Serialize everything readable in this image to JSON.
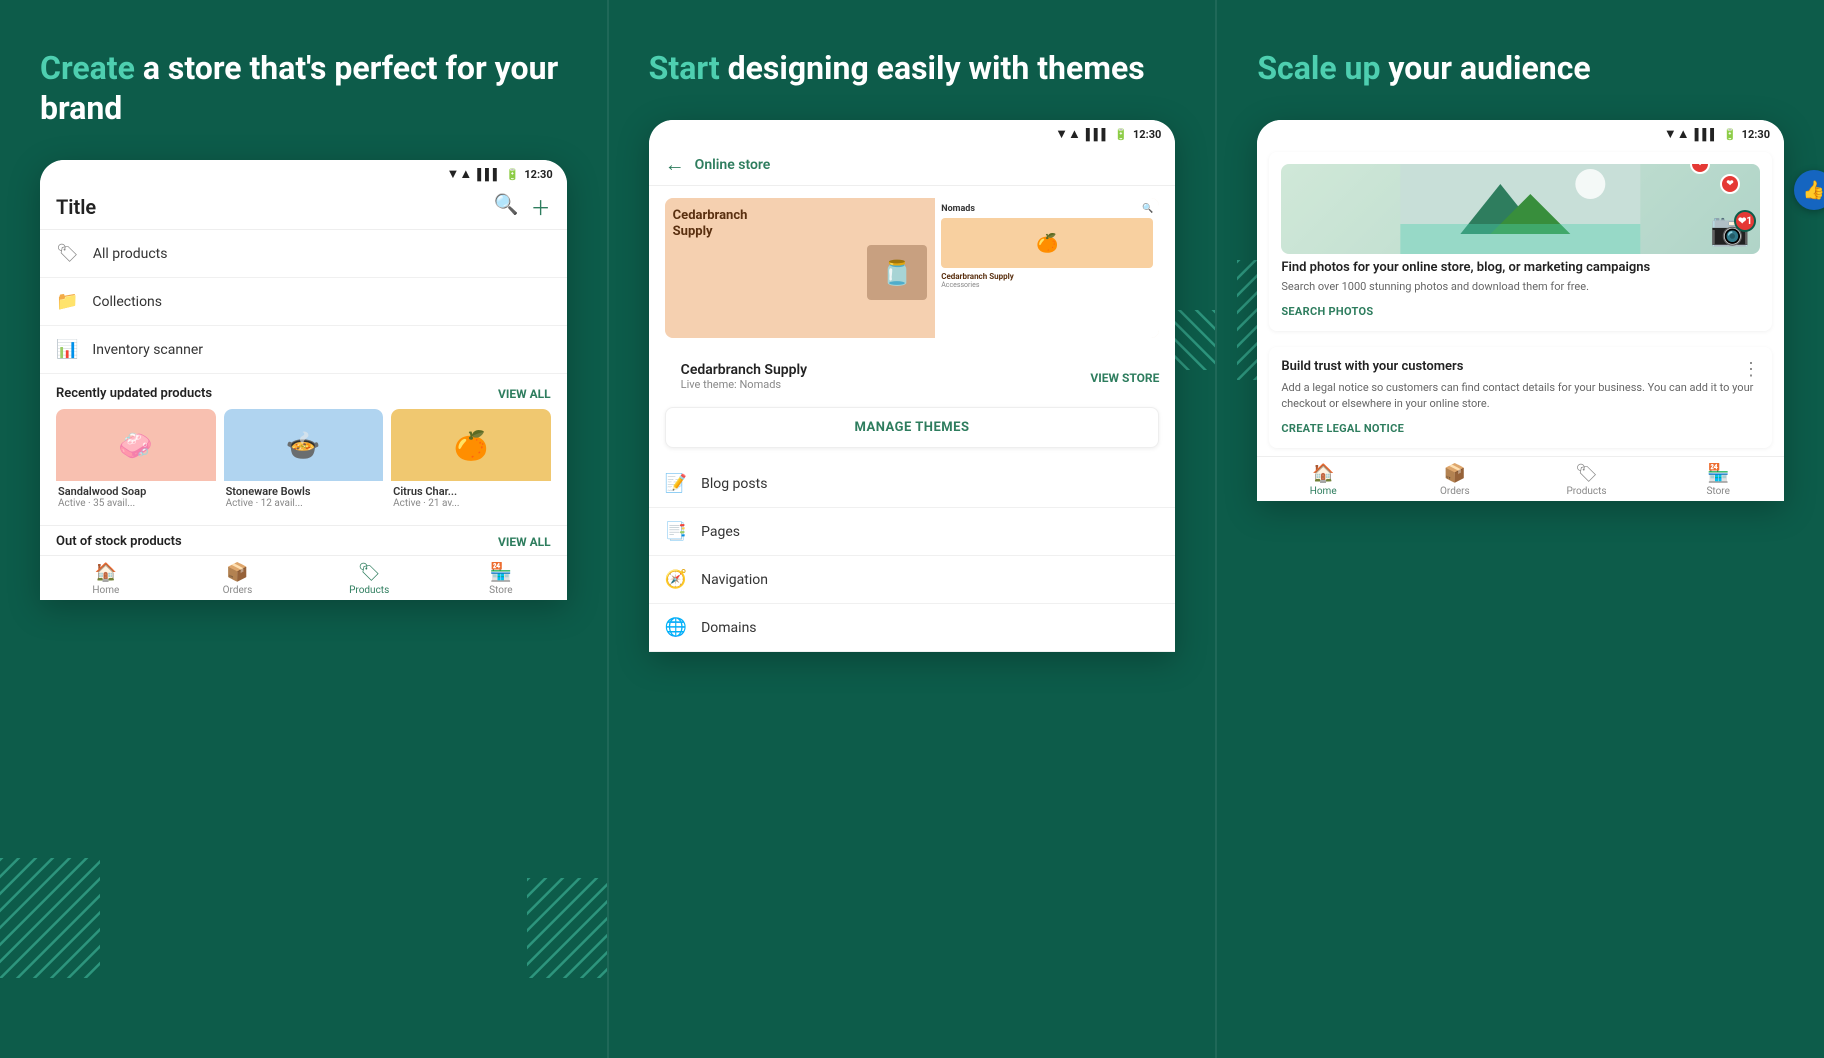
{
  "panel1": {
    "headline_accent": "Create",
    "headline_rest": " a store that's perfect for your brand",
    "phone": {
      "status_time": "12:30",
      "title": "Title",
      "menu": [
        {
          "icon": "🏷",
          "label": "All products"
        },
        {
          "icon": "📁",
          "label": "Collections"
        },
        {
          "icon": "📊",
          "label": "Inventory scanner"
        }
      ],
      "recently_updated": "Recently updated products",
      "view_all": "VIEW ALL",
      "products": [
        {
          "name": "Sandalwood Soap",
          "meta": "Active · 35 avail...",
          "color": "pink",
          "emoji": "🧼"
        },
        {
          "name": "Stoneware Bowls",
          "meta": "Active · 12 avail...",
          "color": "blue",
          "emoji": "🍲"
        },
        {
          "name": "Citrus Char...",
          "meta": "Active · 21 av...",
          "color": "orange",
          "emoji": "🍊"
        }
      ],
      "out_of_stock": "Out of stock products",
      "out_view_all": "VIEW ALL",
      "nav": [
        {
          "label": "Home",
          "icon": "🏠",
          "active": false
        },
        {
          "label": "Orders",
          "icon": "📦",
          "active": false
        },
        {
          "label": "Products",
          "icon": "🏷",
          "active": true
        },
        {
          "label": "Store",
          "icon": "🏪",
          "active": false
        }
      ]
    }
  },
  "panel2": {
    "headline_accent": "Start",
    "headline_rest": " designing easily with themes",
    "phone": {
      "status_time": "12:30",
      "back_label": "Online store",
      "store_name": "Cedarbranch Supply",
      "store_theme": "Live theme: Nomads",
      "view_store": "VIEW STORE",
      "manage_themes": "MANAGE THEMES",
      "menu": [
        {
          "icon": "📄",
          "label": "Blog posts"
        },
        {
          "icon": "📑",
          "label": "Pages"
        },
        {
          "icon": "🧭",
          "label": "Navigation"
        },
        {
          "icon": "🌐",
          "label": "Domains"
        }
      ]
    }
  },
  "panel3": {
    "headline_accent": "Scale up",
    "headline_rest": " your audience",
    "phone": {
      "status_time": "12:30",
      "like_count": "1",
      "card1": {
        "title": "Find photos for your online store, blog, or marketing campaigns",
        "desc": "Search over 1000 stunning photos and download them for free.",
        "link": "SEARCH PHOTOS"
      },
      "card2": {
        "title": "Build trust with your customers",
        "desc": "Add a legal notice so customers can find contact details for your business. You can add it to your checkout or elsewhere in your online store.",
        "link": "CREATE LEGAL NOTICE"
      },
      "nav": [
        {
          "label": "Home",
          "icon": "🏠",
          "active": true
        },
        {
          "label": "Orders",
          "icon": "📦",
          "active": false
        },
        {
          "label": "Products",
          "icon": "🏷",
          "active": false
        },
        {
          "label": "Store",
          "icon": "🏪",
          "active": false
        }
      ]
    }
  }
}
